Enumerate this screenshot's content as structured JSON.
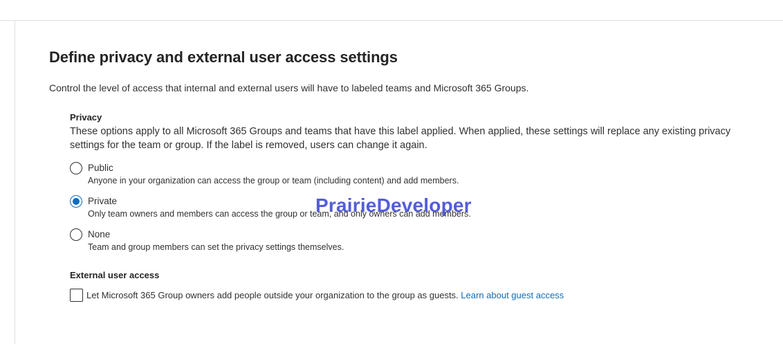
{
  "page": {
    "title": "Define privacy and external user access settings",
    "description": "Control the level of access that internal and external users will have to labeled teams and Microsoft 365 Groups."
  },
  "privacy": {
    "title": "Privacy",
    "description": "These options apply to all Microsoft 365 Groups and teams that have this label applied. When applied, these settings will replace any existing privacy settings for the team or group. If the label is removed, users can change it again.",
    "selected": "private",
    "options": [
      {
        "id": "public",
        "label": "Public",
        "description": "Anyone in your organization can access the group or team (including content) and add members."
      },
      {
        "id": "private",
        "label": "Private",
        "description": "Only team owners and members can access the group or team, and only owners can add members."
      },
      {
        "id": "none",
        "label": "None",
        "description": "Team and group members can set the privacy settings themselves."
      }
    ]
  },
  "external": {
    "title": "External user access",
    "checkbox_label": "Let Microsoft 365 Group owners add people outside your organization to the group as guests.",
    "checked": false,
    "link_text": "Learn about guest access"
  },
  "watermark": "PrairieDeveloper",
  "colors": {
    "accent": "#0f6cbd",
    "watermark": "#4b55d8",
    "text": "#323130"
  }
}
